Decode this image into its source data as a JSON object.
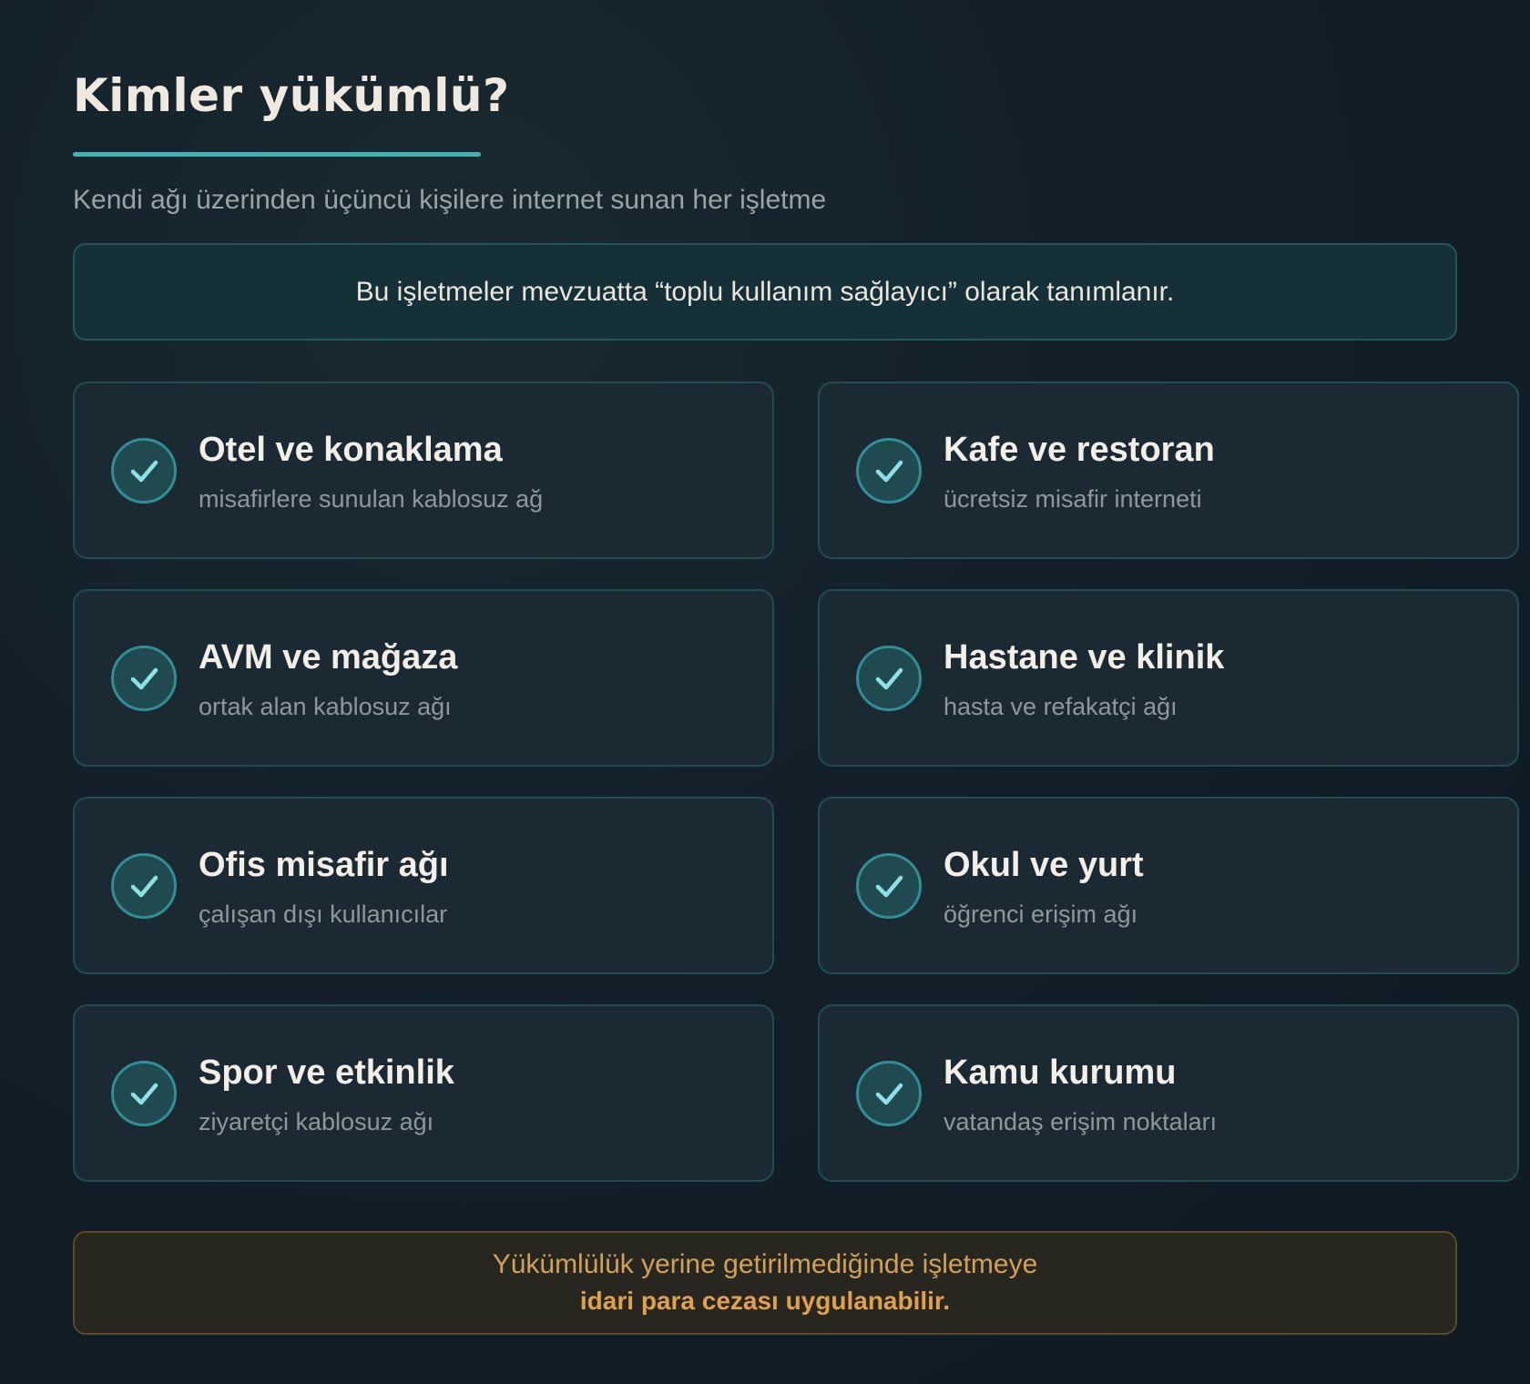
{
  "header": {
    "title": "Kimler yükümlü?",
    "subtitle": "Kendi ağı üzerinden üçüncü kişilere internet sunan her işletme"
  },
  "info": {
    "text": "Bu işletmeler mevzuatta “toplu kullanım sağlayıcı” olarak tanımlanır."
  },
  "cards": [
    {
      "title": "Otel ve konaklama",
      "subtitle": "misafirlere sunulan kablosuz ağ",
      "icon": "check-circle-icon"
    },
    {
      "title": "Kafe ve restoran",
      "subtitle": "ücretsiz misafir interneti",
      "icon": "check-circle-icon"
    },
    {
      "title": "AVM ve mağaza",
      "subtitle": "ortak alan kablosuz ağı",
      "icon": "check-circle-icon"
    },
    {
      "title": "Hastane ve klinik",
      "subtitle": "hasta ve refakatçi ağı",
      "icon": "check-circle-icon"
    },
    {
      "title": "Ofis misafir ağı",
      "subtitle": "çalışan dışı kullanıcılar",
      "icon": "check-circle-icon"
    },
    {
      "title": "Okul ve yurt",
      "subtitle": "öğrenci erişim ağı",
      "icon": "check-circle-icon"
    },
    {
      "title": "Spor ve etkinlik",
      "subtitle": "ziyaretçi kablosuz ağı",
      "icon": "check-circle-icon"
    },
    {
      "title": "Kamu kurumu",
      "subtitle": "vatandaş erişim noktaları",
      "icon": "check-circle-icon"
    }
  ],
  "warning": {
    "line1": "Yükümlülük yerine getirilmediğinde işletmeye",
    "line2": "idari para cezası uygulanabilir."
  },
  "colors": {
    "accent": "#3fb3b8",
    "warning": "#e0a14a",
    "background": "#13202a"
  }
}
